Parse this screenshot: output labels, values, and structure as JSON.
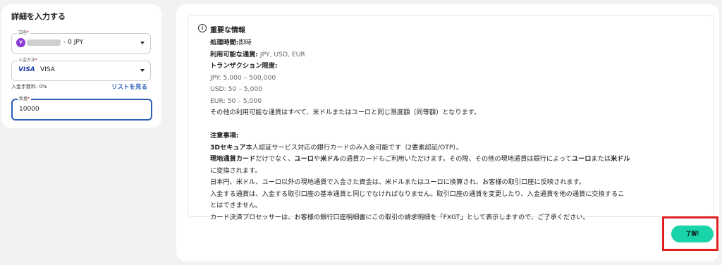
{
  "form": {
    "title": "詳細を入力する",
    "account_label": "口座",
    "account_currency_symbol": "¥",
    "account_value": "- 0 JPY",
    "payment_label": "入金方法",
    "payment_logo": "VISA",
    "payment_value": "VISA",
    "fee_text": "入金手数料: 0%",
    "list_link": "リストを見る",
    "amount_label": "数量",
    "amount_value": "10000"
  },
  "info": {
    "title": "重要な情報",
    "processing_label": "処理時間:",
    "processing_value": "即時",
    "currencies_label": "利用可能な通貨:",
    "currencies_value": " JPY, USD, EUR",
    "limits_label": "トランザクション限度:",
    "limit_jpy": "JPY: 5,000 – 500,000",
    "limit_usd": "USD: 50 – 5,000",
    "limit_eur": "EUR: 50 – 5,000",
    "other_currencies": "その他の利用可能な通貨はすべて、米ドルまたはユーロと同じ限度額（同等額）となります。",
    "notes_label": "注意事項:",
    "note1_bold": "3Dセキュア",
    "note1_rest": "本人認証サービス対応の銀行カードのみ入金可能です（2要素認証/OTP）。",
    "note2_b1": "現地通貨カード",
    "note2_t1": "だけでなく、",
    "note2_b2": "ユーロ",
    "note2_t2": "や",
    "note2_b3": "米ドル",
    "note2_t3": "の通貨カードもご利用いただけます。その際、その他の現地通貨は銀行によって",
    "note2_b4": "ユーロ",
    "note2_t4": "または",
    "note2_b5": "米ドル",
    "note2_cont": "に変換されます。",
    "note3": "日本円、米ドル、ユーロ以外の現地通貨で入金さた資金は、米ドルまたはユーロに換算され、お客様の取引口座に反映されます。",
    "note4_line1": "入金する通貨は、入金する取引口座の基本通貨と同じでなければなりません。取引口座の通貨を変更したり、入金通貨を他の通貨に交換するこ",
    "note4_line2": "とはできません。",
    "note5": "カード決済プロセッサーは、お客様の銀行口座明細書にこの取引の請求明細を「FXGT」として表示しますので、ご了承ください。"
  },
  "actions": {
    "ok_label": "了解!"
  },
  "colors": {
    "accent": "#18d4a8",
    "link": "#2b5eb8",
    "highlight_border": "#e02020",
    "focus_border": "#2c5fb8"
  },
  "icons": [
    "yen-coin-icon",
    "visa-logo-icon",
    "dropdown-caret-icon",
    "info-circle-icon"
  ]
}
